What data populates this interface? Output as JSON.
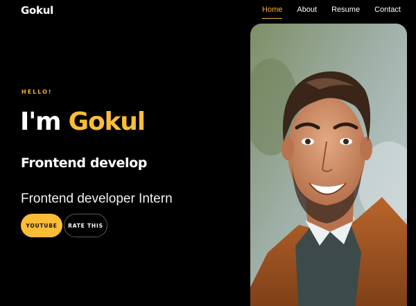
{
  "header": {
    "logo": "Gokul",
    "nav": [
      {
        "label": "Home",
        "active": true
      },
      {
        "label": "About",
        "active": false
      },
      {
        "label": "Resume",
        "active": false
      },
      {
        "label": "Contact",
        "active": false
      }
    ]
  },
  "hero": {
    "eyebrow": "HELLO!",
    "greeting": "I'm",
    "name": "Gokul",
    "typed_text": "Frontend develop",
    "role": "Frontend developer Intern",
    "buttons": {
      "youtube": "YOUTUBE",
      "rate": "RATE THIS"
    }
  },
  "colors": {
    "accent": "#fbbd38",
    "background": "#000000",
    "text": "#ffffff"
  },
  "image": {
    "icon": "portrait-photo"
  }
}
